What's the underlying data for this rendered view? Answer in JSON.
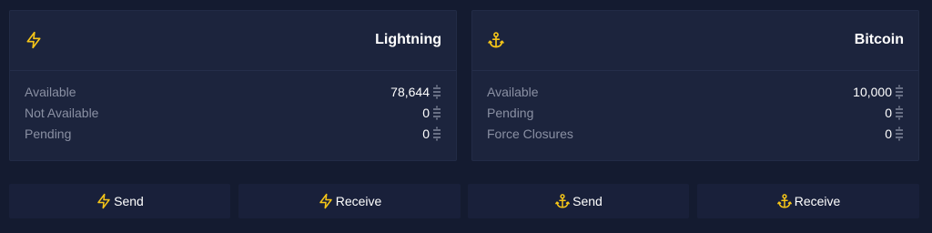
{
  "colors": {
    "accent": "#f5c518",
    "background": "#141b30",
    "card": "#1c243d",
    "label": "#8a90a3"
  },
  "lightning": {
    "icon": "lightning-bolt-icon",
    "title": "Lightning",
    "rows": [
      {
        "label": "Available",
        "value": "78,644"
      },
      {
        "label": "Not Available",
        "value": "0"
      },
      {
        "label": "Pending",
        "value": "0"
      }
    ]
  },
  "bitcoin": {
    "icon": "anchor-icon",
    "title": "Bitcoin",
    "rows": [
      {
        "label": "Available",
        "value": "10,000"
      },
      {
        "label": "Pending",
        "value": "0"
      },
      {
        "label": "Force Closures",
        "value": "0"
      }
    ]
  },
  "buttons": {
    "ln_send": "Send",
    "ln_receive": "Receive",
    "btc_send": "Send",
    "btc_receive": "Receive"
  },
  "unit_icon": "satoshi-icon"
}
